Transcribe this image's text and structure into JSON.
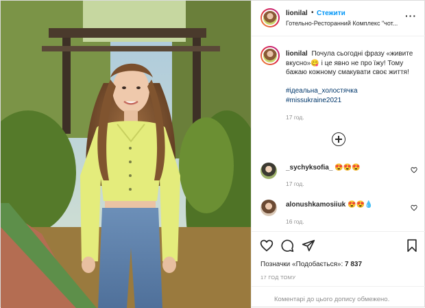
{
  "header": {
    "username": "lionilal",
    "dot": "•",
    "follow_label": "Стежити",
    "location": "Готельно-Ресторанний Комплекс \"чот...",
    "more_icon": "more-horizontal-icon"
  },
  "caption": {
    "username": "lionilal",
    "text": "Почула сьогодні фразу «живите вкусно»😋 і це явно не про їжу! Тому бажаю кожному смакувати своє життя!",
    "hashtags": [
      "#ідеальна_холостячка",
      "#missukraine2021"
    ],
    "time": "17 год."
  },
  "load_more_icon": "plus-circle-icon",
  "comments": [
    {
      "username": "_sychyksofia_",
      "text": "😍😍😍",
      "time": "17 год."
    },
    {
      "username": "alonushkamosiiuk",
      "text": "😍😍💧",
      "time": "16 год."
    }
  ],
  "actions": {
    "like_icon": "heart-icon",
    "comment_icon": "comment-icon",
    "share_icon": "share-icon",
    "save_icon": "bookmark-icon"
  },
  "likes": {
    "label": "Позначки «Подобається»: ",
    "count": "7 837"
  },
  "timestamp": "17 ГОД ТОМУ",
  "footer_notice": "Коментарі до цього допису обмежено.",
  "colors": {
    "accent": "#0095f6",
    "hashtag": "#00376b",
    "muted": "#8e8e8e",
    "border": "#efefef"
  }
}
